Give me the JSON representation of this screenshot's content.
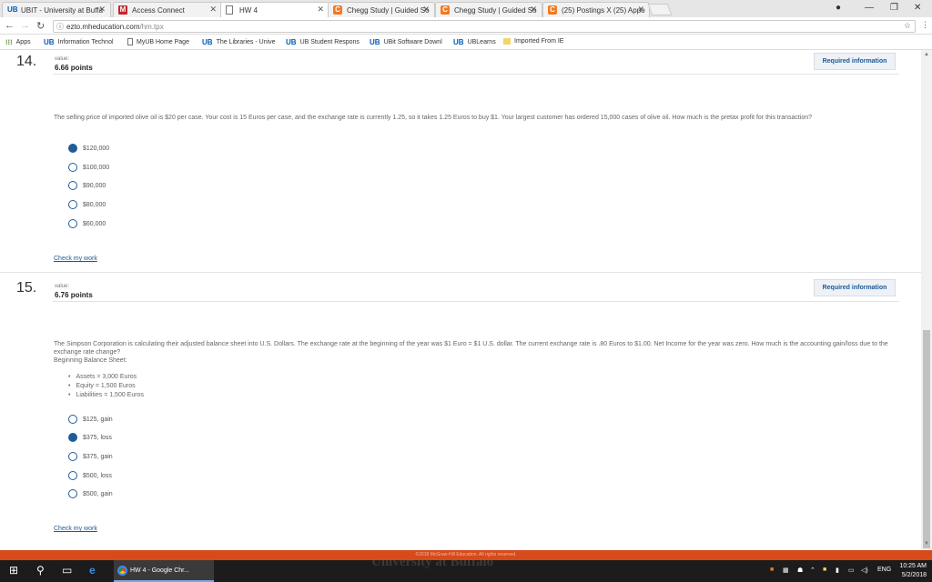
{
  "browser": {
    "tabs": [
      {
        "icon": "ub-icon",
        "label": "UBIT - University at Buffa",
        "active": false
      },
      {
        "icon": "m-icon",
        "label": "Access Connect",
        "active": false
      },
      {
        "icon": "doc-icon",
        "label": "HW 4",
        "active": true
      },
      {
        "icon": "chegg-icon",
        "label": "Chegg Study | Guided So",
        "active": false
      },
      {
        "icon": "chegg-icon",
        "label": "Chegg Study | Guided So",
        "active": false
      },
      {
        "icon": "chegg-icon",
        "label": "(25) Postings X (25) Appo",
        "active": false
      }
    ],
    "url_host": "ezto.mheducation.com",
    "url_path": "/hm.tpx",
    "bookmarks": [
      {
        "icon": "apps-icon",
        "label": "Apps"
      },
      {
        "icon": "ub-icon",
        "label": "Information Technol"
      },
      {
        "icon": "doc-icon",
        "label": "MyUB Home Page"
      },
      {
        "icon": "ub-icon",
        "label": "The Libraries - Unive"
      },
      {
        "icon": "ub-icon",
        "label": "UB Student Respons"
      },
      {
        "icon": "ub-icon",
        "label": "UBit Software Downl"
      },
      {
        "icon": "ub-icon",
        "label": "UBLearns"
      },
      {
        "icon": "folder-icon",
        "label": "Imported From IE"
      }
    ]
  },
  "questions": [
    {
      "number": "14.",
      "value_label": "value:",
      "points": "6.66 points",
      "required_label": "Required information",
      "text": "The selling price of imported olive oil is $20 per case. Your cost is 15 Euros per case, and the exchange rate is currently 1.25, so it takes 1.25 Euros to buy $1. Your largest customer has ordered 15,000 cases of olive oil. How much is the pretax profit for this transaction?",
      "options": [
        {
          "label": "$120,000",
          "selected": true
        },
        {
          "label": "$100,000",
          "selected": false
        },
        {
          "label": "$90,000",
          "selected": false
        },
        {
          "label": "$80,000",
          "selected": false
        },
        {
          "label": "$60,000",
          "selected": false
        }
      ],
      "check_label": "Check my work"
    },
    {
      "number": "15.",
      "value_label": "value:",
      "points": "6.76 points",
      "required_label": "Required information",
      "text": "The Simpson Corporation is calculating their adjusted balance sheet into U.S. Dollars. The exchange rate at the beginning of the year was $1 Euro = $1 U.S. dollar. The current exchange rate is .80 Euros to $1.00. Net Income for the year was zero. How much is the accounting gain/loss due to the exchange rate change?",
      "subheading": "Beginning Balance Sheet:",
      "bullets": [
        "Assets = 3,000 Euros",
        "Equity = 1,500 Euros",
        "Liabilities = 1,500 Euros"
      ],
      "options": [
        {
          "label": "$125, gain",
          "selected": false
        },
        {
          "label": "$375, loss",
          "selected": true
        },
        {
          "label": "$375, gain",
          "selected": false
        },
        {
          "label": "$500, loss",
          "selected": false
        },
        {
          "label": "$500, gain",
          "selected": false
        }
      ],
      "check_label": "Check my work"
    }
  ],
  "footer": {
    "copyright": "©2018 McGraw-Hill Education. All rights reserved."
  },
  "taskbar": {
    "task_label": "HW 4 - Google Chr...",
    "watermark": "University at Buffalo",
    "language": "ENG",
    "time": "10:25 AM",
    "date": "5/2/2018"
  },
  "colors": {
    "accent": "#1f5c99",
    "footer": "#d64a1b",
    "link": "#1a5a96"
  }
}
